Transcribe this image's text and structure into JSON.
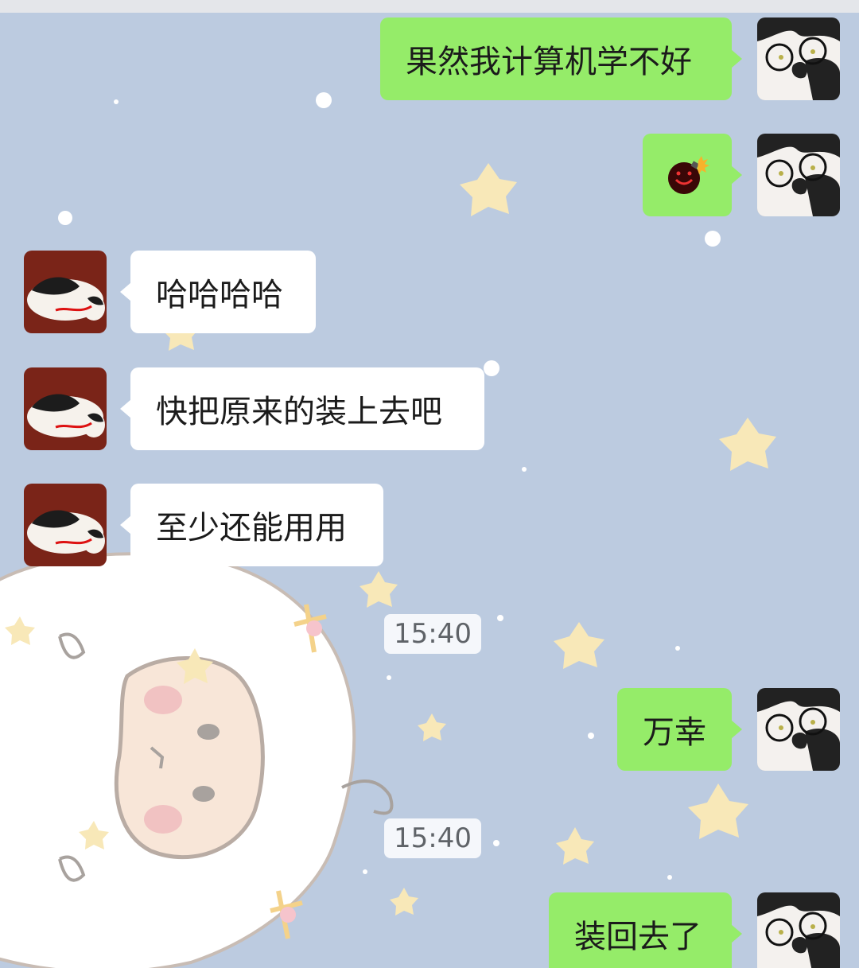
{
  "messages": [
    {
      "side": "mine",
      "text": "果然我计算机学不好"
    },
    {
      "side": "mine",
      "emoji": "bomb-sticker"
    },
    {
      "side": "theirs",
      "text": "哈哈哈哈"
    },
    {
      "side": "theirs",
      "text": "快把原来的装上去吧"
    },
    {
      "side": "theirs",
      "text": "至少还能用用"
    },
    {
      "side": "mine",
      "text": "万幸"
    },
    {
      "side": "mine",
      "text": "装回去了"
    }
  ],
  "timestamps": [
    "15:40",
    "15:40"
  ],
  "colors": {
    "chat_background": "#bccbe0",
    "my_bubble": "#95ec69",
    "their_bubble": "#ffffff"
  },
  "icons": {
    "my_avatar": "cat-with-glasses-avatar",
    "their_avatar": "black-white-cat-avatar",
    "background": "sheep-wallpaper"
  }
}
